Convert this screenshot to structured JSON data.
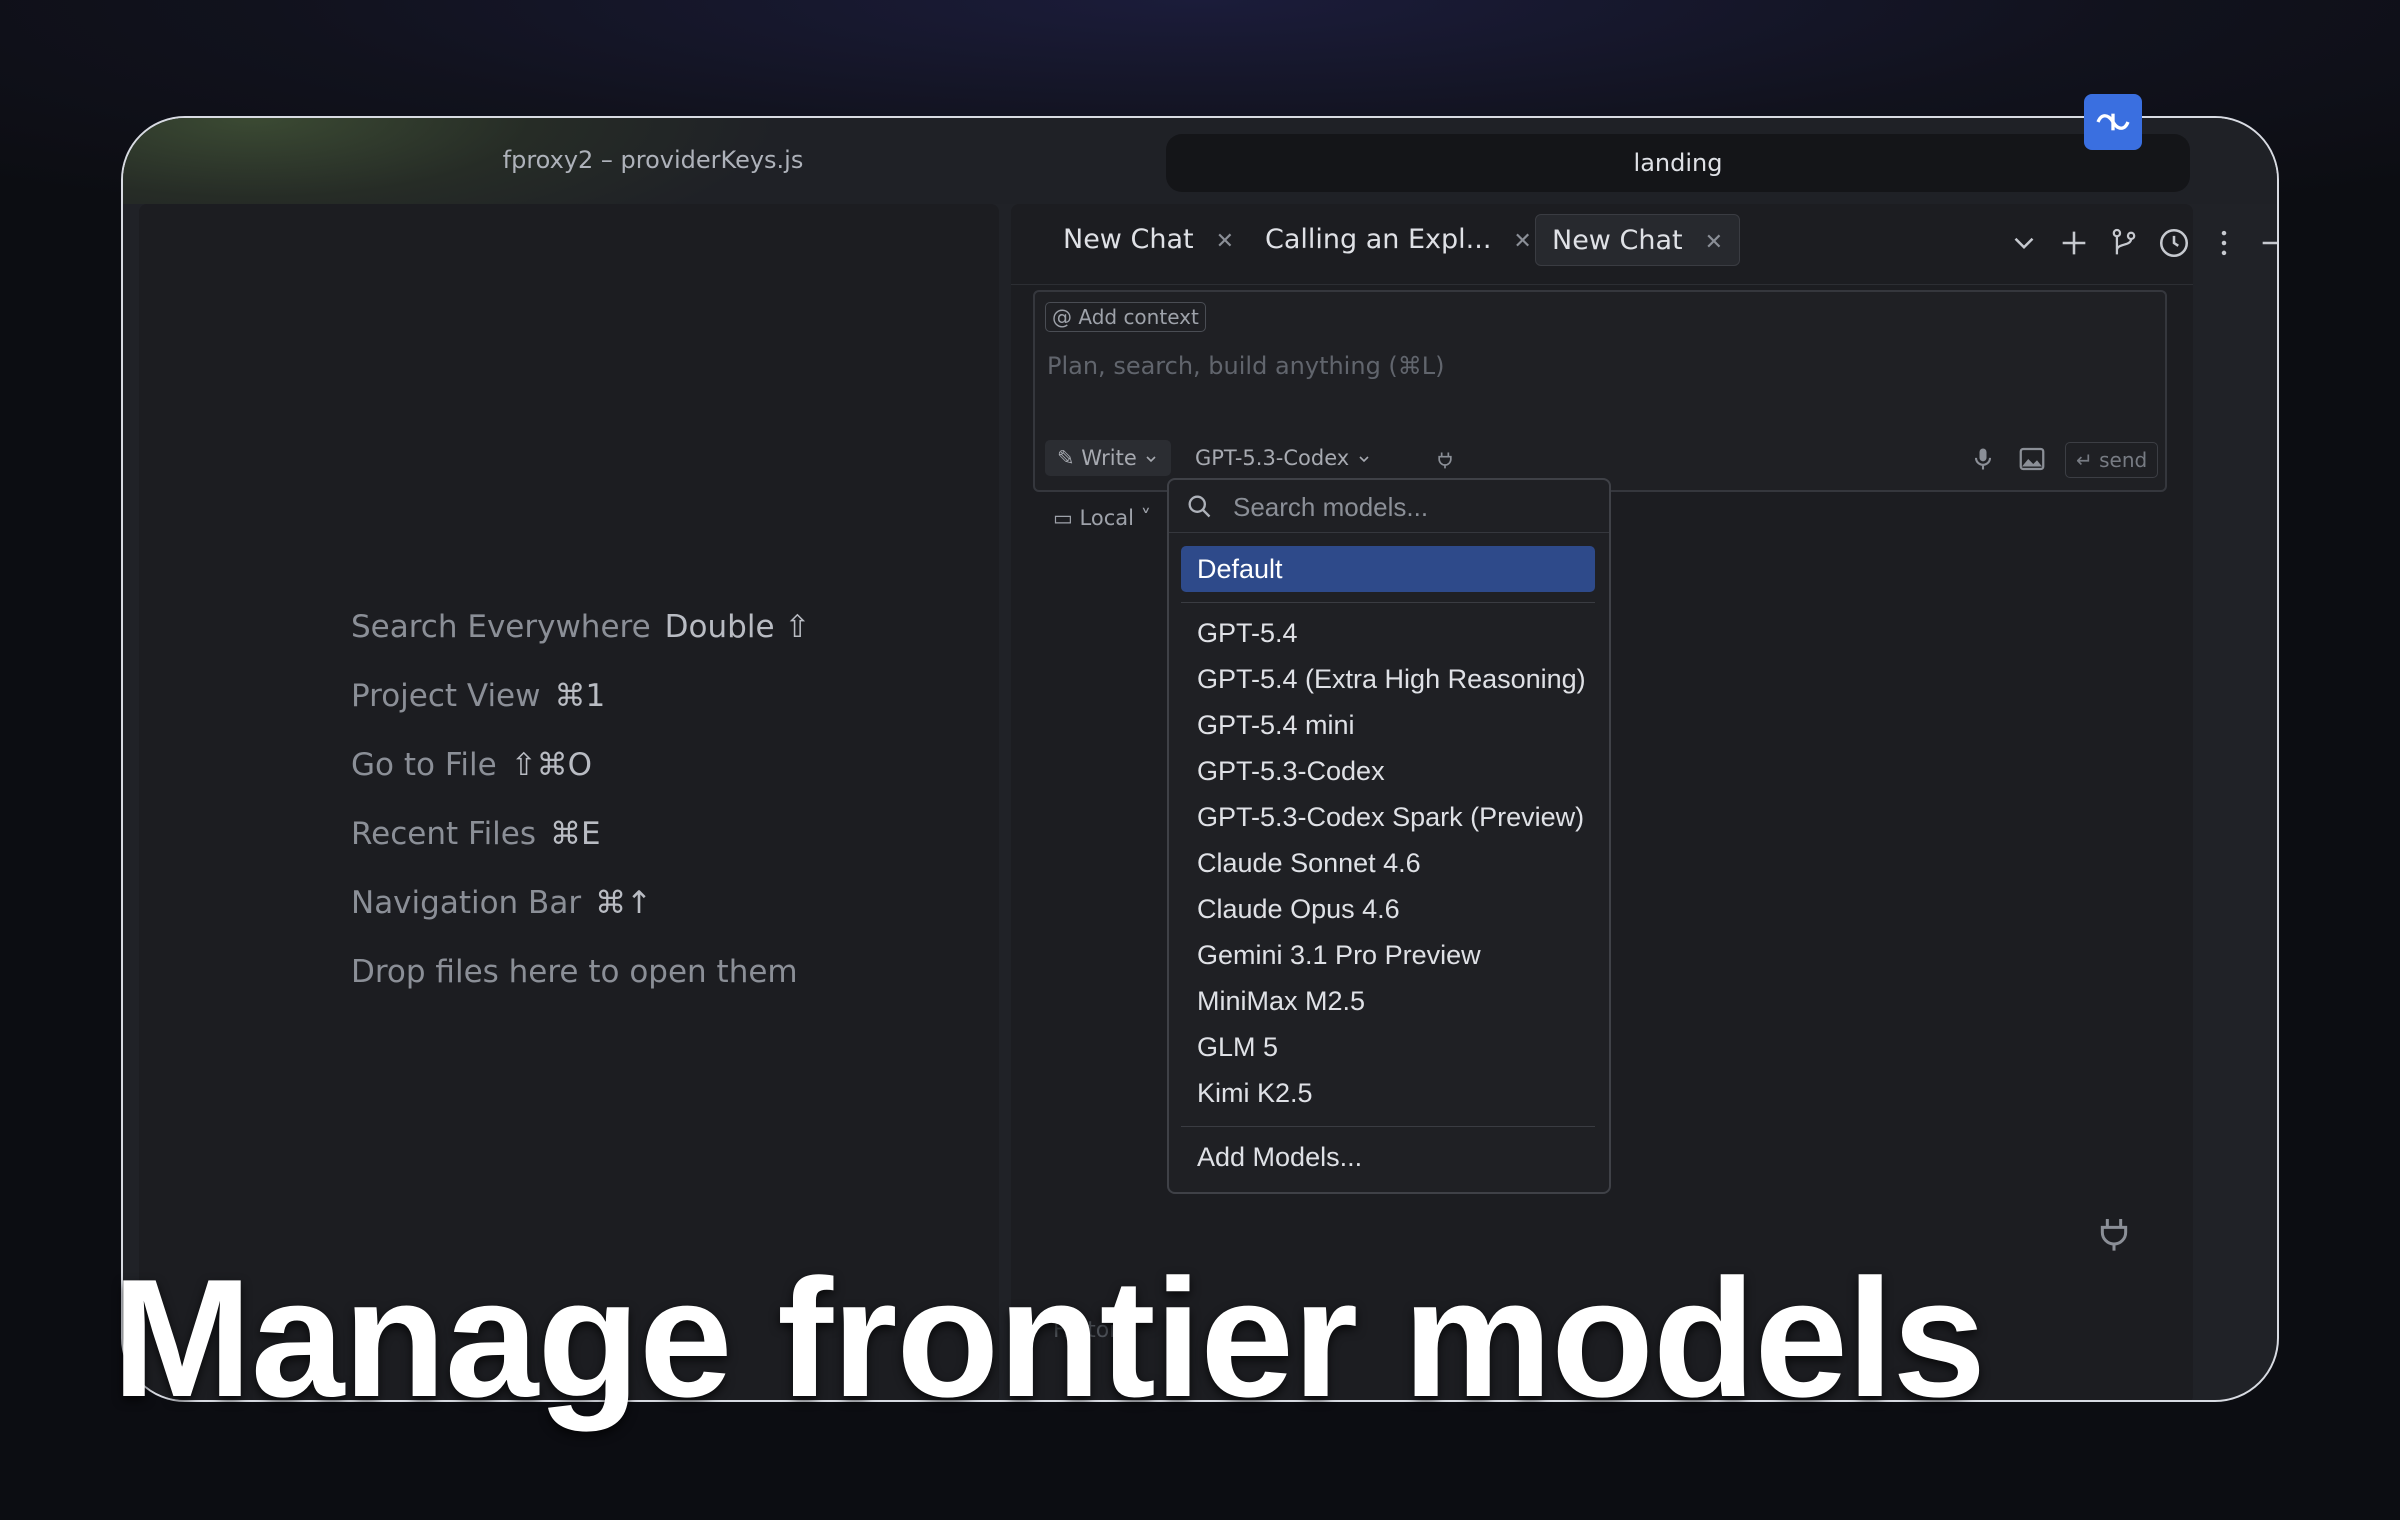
{
  "window": {
    "project_title": "fproxy2 – providerKeys.js",
    "landing_tab": "landing"
  },
  "hints": [
    {
      "label": "Search Everywhere",
      "key": "Double ⇧"
    },
    {
      "label": "Project View",
      "key": "⌘1"
    },
    {
      "label": "Go to File",
      "key": "⇧⌘O"
    },
    {
      "label": "Recent Files",
      "key": "⌘E"
    },
    {
      "label": "Navigation Bar",
      "key": "⌘↑"
    },
    {
      "label": "Drop files here to open them",
      "key": ""
    }
  ],
  "chat_tabs": [
    {
      "label": "New Chat",
      "active": false
    },
    {
      "label": "Calling an Expl...",
      "active": false
    },
    {
      "label": "New Chat",
      "active": true
    }
  ],
  "toolbar_icons": [
    "chevron-down-icon",
    "plus-icon",
    "branch-icon",
    "history-icon",
    "more-icon",
    "minimize-icon"
  ],
  "composer": {
    "add_context": "Add context",
    "placeholder": "Plan, search, build anything (⌘L)",
    "mode": "Write",
    "model": "GPT-5.3-Codex",
    "send": "send",
    "location": "Local"
  },
  "dropdown": {
    "search_placeholder": "Search models...",
    "selected": "Default",
    "models": [
      "GPT-5.4",
      "GPT-5.4 (Extra High Reasoning)",
      "GPT-5.4 mini",
      "GPT-5.3-Codex",
      "GPT-5.3-Codex Spark (Preview)",
      "Claude Sonnet 4.6",
      "Claude Opus 4.6",
      "Gemini 3.1 Pro Preview",
      "MiniMax M2.5",
      "GLM 5",
      "Kimi K2.5"
    ],
    "footer": "Add Models..."
  },
  "banner": "Manage frontier models",
  "colors": {
    "accent": "#3a6fe0",
    "selected_item": "#2e4a8a",
    "frame": "#d8dbe2"
  }
}
